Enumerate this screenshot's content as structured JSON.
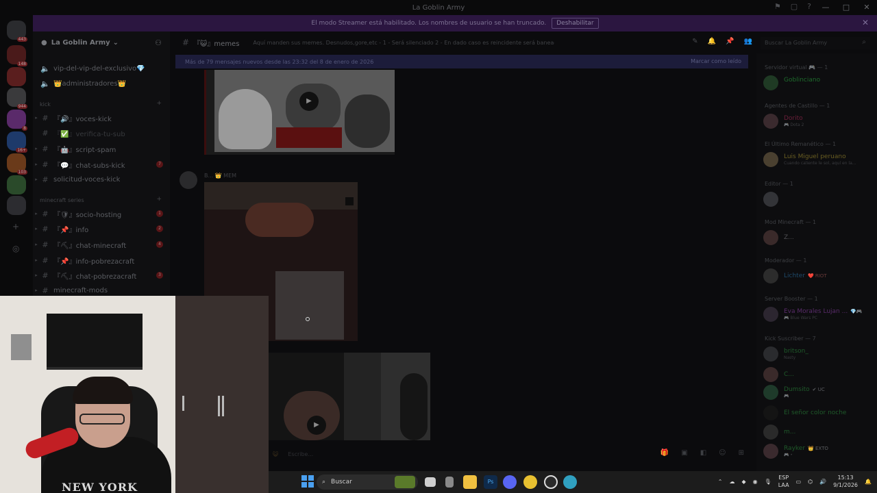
{
  "window": {
    "title": "La Goblin Army"
  },
  "banner": {
    "text": "El modo Streamer está habilitado. Los nombres de usuario se han truncado.",
    "button": "Deshabilitar"
  },
  "guild": {
    "name": "La Goblin Army"
  },
  "channels": [
    {
      "name": "vip-del-vip-del-exclusivo💎",
      "type": "voice"
    },
    {
      "name": "👑administradores👑",
      "type": "voice"
    },
    {
      "name": "『🔊』voces-kick",
      "type": "text"
    },
    {
      "name": "『✅』verifica-tu-sub",
      "type": "text"
    },
    {
      "name": "『🤖』script-spam",
      "type": "text"
    },
    {
      "name": "『💬』chat-subs-kick",
      "type": "text",
      "ping": "7"
    },
    {
      "name": "solicitud-voces-kick",
      "type": "text"
    },
    {
      "name": "『🛡』socio-hosting",
      "type": "text",
      "ping": "1"
    },
    {
      "name": "『📌』info",
      "type": "text",
      "ping": "2"
    },
    {
      "name": "『⛏』chat-minecraft",
      "type": "text",
      "ping": "4"
    },
    {
      "name": "『📌』info-pobrezacraft",
      "type": "text"
    },
    {
      "name": "『⛏』chat-pobrezacraft",
      "type": "text",
      "ping": "3"
    },
    {
      "name": "minecraft-mods",
      "type": "text"
    }
  ],
  "categories": {
    "kick": "kick",
    "minecraft": "minecraft series"
  },
  "chat": {
    "channel": "『😺』memes",
    "topic": "Aquí manden sus memes. Desnudos,gore,etc - 1 - Será silenciado 2 - En dado caso es reincidente será baneado",
    "new_messages": "Más de 79 mensajes nuevos desde las 23:32 del 8 de enero de 2026",
    "mark_read": "Marcar como leído",
    "msg_author": "B... 👑 MEM",
    "composer_placeholder": "Escribe..."
  },
  "search": {
    "placeholder": "Buscar La Goblin Army"
  },
  "members": {
    "roles": [
      {
        "label": "Servidor virtual 🎮 — 1",
        "names": [
          {
            "name": "Goblinciano",
            "color": "#1e6b2c",
            "sub": ""
          }
        ]
      },
      {
        "label": "Agentes de Castillo — 1",
        "names": [
          {
            "name": "Dorito",
            "color": "#6b1f3a",
            "sub": "🎮 Dota 2"
          }
        ]
      },
      {
        "label": "El Último Remanético — 1",
        "names": [
          {
            "name": "Luis Miguel peruano",
            "color": "#6a5e22",
            "sub": "Cuando caliente le sol, aquí en la..."
          }
        ]
      },
      {
        "label": "Editor — 1",
        "names": [
          {
            "name": "",
            "color": "#555",
            "sub": ""
          }
        ]
      },
      {
        "label": "Mod Minecraft — 1",
        "names": [
          {
            "name": "Z...",
            "color": "#4f4f52",
            "sub": ""
          }
        ]
      },
      {
        "label": "Moderador — 1",
        "names": [
          {
            "name": "Lichter",
            "color": "#1e4a6a",
            "sub": "",
            "tag": "❤️ RIOT"
          }
        ]
      },
      {
        "label": "Server Booster — 1",
        "names": [
          {
            "name": "Eva Morales Lujan ...",
            "color": "#5a2c6b",
            "sub": "🎮 Blue Wars PC",
            "tag": "💎🎮"
          }
        ]
      },
      {
        "label": "Kick Suscriber — 7",
        "names": [
          {
            "name": "britson_",
            "color": "#1f5a2a",
            "sub": "Nasty"
          },
          {
            "name": "C...",
            "color": "#1f5a2a",
            "sub": ""
          },
          {
            "name": "Dumsito",
            "color": "#1f5a2a",
            "sub": "🎮",
            "tag": "✔ UC"
          },
          {
            "name": "El señor color noche",
            "color": "#1f5a2a",
            "sub": ""
          },
          {
            "name": "m...",
            "color": "#1f5a2a",
            "sub": ""
          },
          {
            "name": "Rayker",
            "color": "#1f5a2a",
            "sub": "🎮 •",
            "tag": "👑 EXTO"
          }
        ]
      }
    ]
  },
  "taskbar": {
    "search": "Buscar",
    "lang_top": "ESP",
    "lang_bottom": "LAA",
    "time": "15:13",
    "date": "9/1/2026"
  },
  "webcam": {
    "hoodie_text": "NEW YORK"
  }
}
